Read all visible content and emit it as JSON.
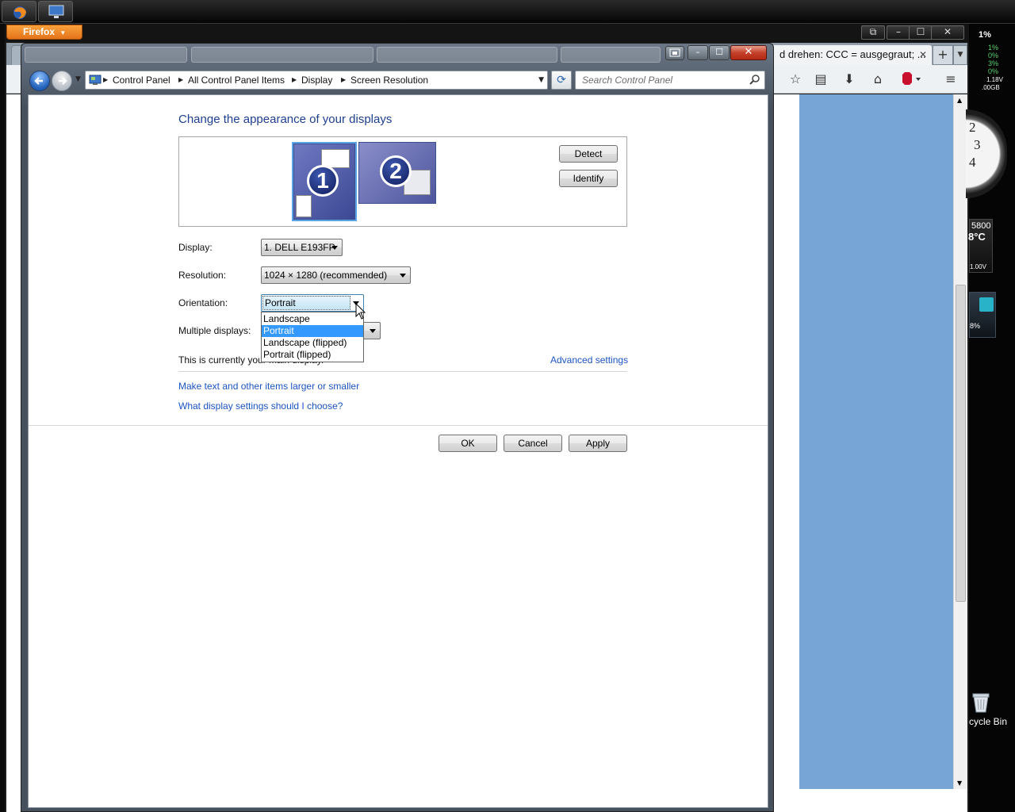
{
  "taskbar": {
    "items": [
      {
        "name": "firefox",
        "icon": "firefox-icon"
      },
      {
        "name": "control-panel",
        "icon": "monitor-icon"
      }
    ]
  },
  "firefox": {
    "menu_label": "Firefox",
    "active_tab_title": "d drehen: CCC = ausgegraut; ...",
    "tab_close": "✕",
    "new_tab": "+",
    "controls": {
      "minimize": "–",
      "maximize": "☐",
      "close": "✕"
    }
  },
  "gadgets": {
    "cpu_percent": "1%",
    "cpu_cores": [
      "1%",
      "0%",
      "3%",
      "0%"
    ],
    "voltage_a": "1.18V",
    "memory": ".00GB",
    "clock_numbers": "2\n3\n4",
    "gpu_model": "5800",
    "gpu_temp": "8°C",
    "gpu_voltage": "1.00V",
    "net_percent": "8%",
    "recycle_bin_label": "cycle Bin"
  },
  "window": {
    "breadcrumbs": [
      "Control Panel",
      "All Control Panel Items",
      "Display",
      "Screen Resolution"
    ],
    "search_placeholder": "Search Control Panel",
    "title": "Change the appearance of your displays",
    "monitors": [
      {
        "number": "1",
        "selected": true
      },
      {
        "number": "2",
        "selected": false
      }
    ],
    "detect_label": "Detect",
    "identify_label": "Identify",
    "display": {
      "label": "Display:",
      "value": "1. DELL E193FP"
    },
    "resolution": {
      "label": "Resolution:",
      "value": "1024 × 1280 (recommended)"
    },
    "orientation": {
      "label": "Orientation:",
      "value": "Portrait",
      "options": [
        "Landscape",
        "Portrait",
        "Landscape (flipped)",
        "Portrait (flipped)"
      ],
      "selected_index": 1
    },
    "multiple_displays": {
      "label": "Multiple displays:"
    },
    "main_display_text": "This is currently your main display.",
    "advanced_settings": "Advanced settings",
    "link_text_size": "Make text and other items larger or smaller",
    "link_what_settings": "What display settings should I choose?",
    "ok_label": "OK",
    "cancel_label": "Cancel",
    "apply_label": "Apply"
  },
  "colors": {
    "link": "#1c54c1",
    "title": "#1e3f8f",
    "selection": "#3399ff",
    "firefox_orange": "#e4731a"
  }
}
